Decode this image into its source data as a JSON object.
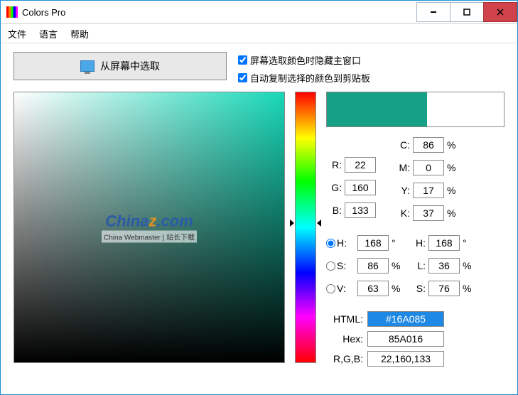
{
  "title": "Colors Pro",
  "menu": {
    "file": "文件",
    "lang": "语言",
    "help": "帮助"
  },
  "pick_button": "从屏幕中选取",
  "checks": {
    "hide_main": "屏幕选取颜色时隐藏主窗口",
    "auto_copy": "自动复制选择的颜色到剪贴板"
  },
  "rgb": {
    "r_lbl": "R:",
    "g_lbl": "G:",
    "b_lbl": "B:",
    "r": "22",
    "g": "160",
    "b": "133"
  },
  "cmyk": {
    "c_lbl": "C:",
    "m_lbl": "M:",
    "y_lbl": "Y:",
    "k_lbl": "K:",
    "c": "86",
    "m": "0",
    "y": "17",
    "k": "37"
  },
  "hsv": {
    "h_lbl": "H:",
    "s_lbl": "S:",
    "v_lbl": "V:",
    "h": "168",
    "s": "86",
    "v": "63"
  },
  "hls": {
    "h_lbl": "H:",
    "l_lbl": "L:",
    "s_lbl": "S:",
    "h": "168",
    "l": "36",
    "s": "76"
  },
  "out": {
    "html_lbl": "HTML:",
    "html_val": "#16A085",
    "hex_lbl": "Hex:",
    "hex_val": "85A016",
    "rgb_lbl": "R,G,B:",
    "rgb_val": "22,160,133"
  },
  "percent": "%",
  "degree": "°",
  "swatch_current": "#16a085",
  "hue_pos_pct": 47,
  "watermark_main": "Chinaz.com",
  "watermark_sub": "China Webmaster | 站长下载"
}
